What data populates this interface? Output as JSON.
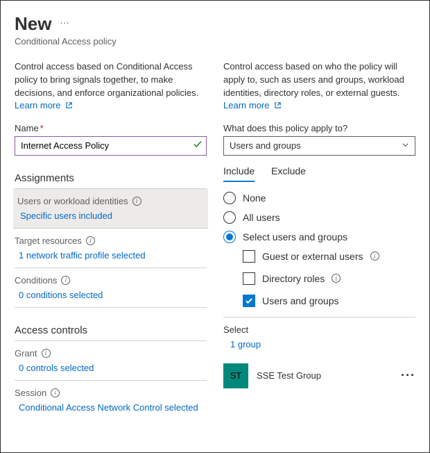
{
  "header": {
    "title": "New",
    "subtitle": "Conditional Access policy"
  },
  "left": {
    "description": "Control access based on Conditional Access policy to bring signals together, to make decisions, and enforce organizational policies.",
    "learn_more": "Learn more",
    "name_label": "Name",
    "name_value": "Internet Access Policy",
    "assignments_header": "Assignments",
    "users_item_label": "Users or workload identities",
    "users_item_link": "Specific users included",
    "target_item_label": "Target resources",
    "target_item_link": "1 network traffic profile selected",
    "conditions_item_label": "Conditions",
    "conditions_item_link": "0 conditions selected",
    "access_controls_header": "Access controls",
    "grant_item_label": "Grant",
    "grant_item_link": "0 controls selected",
    "session_item_label": "Session",
    "session_item_link": "Conditional Access Network Control selected"
  },
  "right": {
    "description": "Control access based on who the policy will apply to, such as users and groups, workload identities, directory roles, or external guests.",
    "learn_more": "Learn more",
    "apply_label": "What does this policy apply to?",
    "apply_value": "Users and groups",
    "tab_include": "Include",
    "tab_exclude": "Exclude",
    "radio_none": "None",
    "radio_all": "All users",
    "radio_select": "Select users and groups",
    "cb_guest": "Guest or external users",
    "cb_roles": "Directory roles",
    "cb_users": "Users and groups",
    "select_header": "Select",
    "select_link": "1 group",
    "group_avatar": "ST",
    "group_name": "SSE Test Group"
  }
}
